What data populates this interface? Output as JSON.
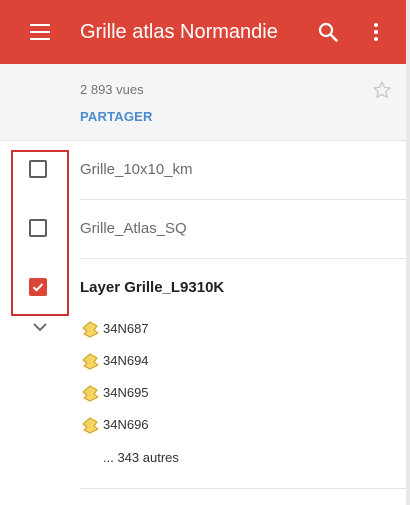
{
  "appbar": {
    "title": "Grille atlas Normandie",
    "menu_icon": "menu-icon",
    "search_icon": "search-icon",
    "more_icon": "more-vert-icon",
    "color": "#db4437"
  },
  "info": {
    "views": "2 893 vues",
    "share_label": "PARTAGER",
    "star_icon": "star-outline-icon"
  },
  "layers": [
    {
      "name": "Grille_10x10_km",
      "checked": false
    },
    {
      "name": "Grille_Atlas_SQ",
      "checked": false
    },
    {
      "name": "Layer Grille_L9310K",
      "checked": true
    }
  ],
  "features": [
    {
      "name": "34N687",
      "icon": "polygon-icon"
    },
    {
      "name": "34N694",
      "icon": "polygon-icon"
    },
    {
      "name": "34N695",
      "icon": "polygon-icon"
    },
    {
      "name": "34N696",
      "icon": "polygon-icon"
    }
  ],
  "more_features": "... 343 autres",
  "colors": {
    "accent": "#db4437",
    "link": "#4a8bd0",
    "highlight_box": "#d0302e",
    "feature_icon": "#f2c94c"
  }
}
